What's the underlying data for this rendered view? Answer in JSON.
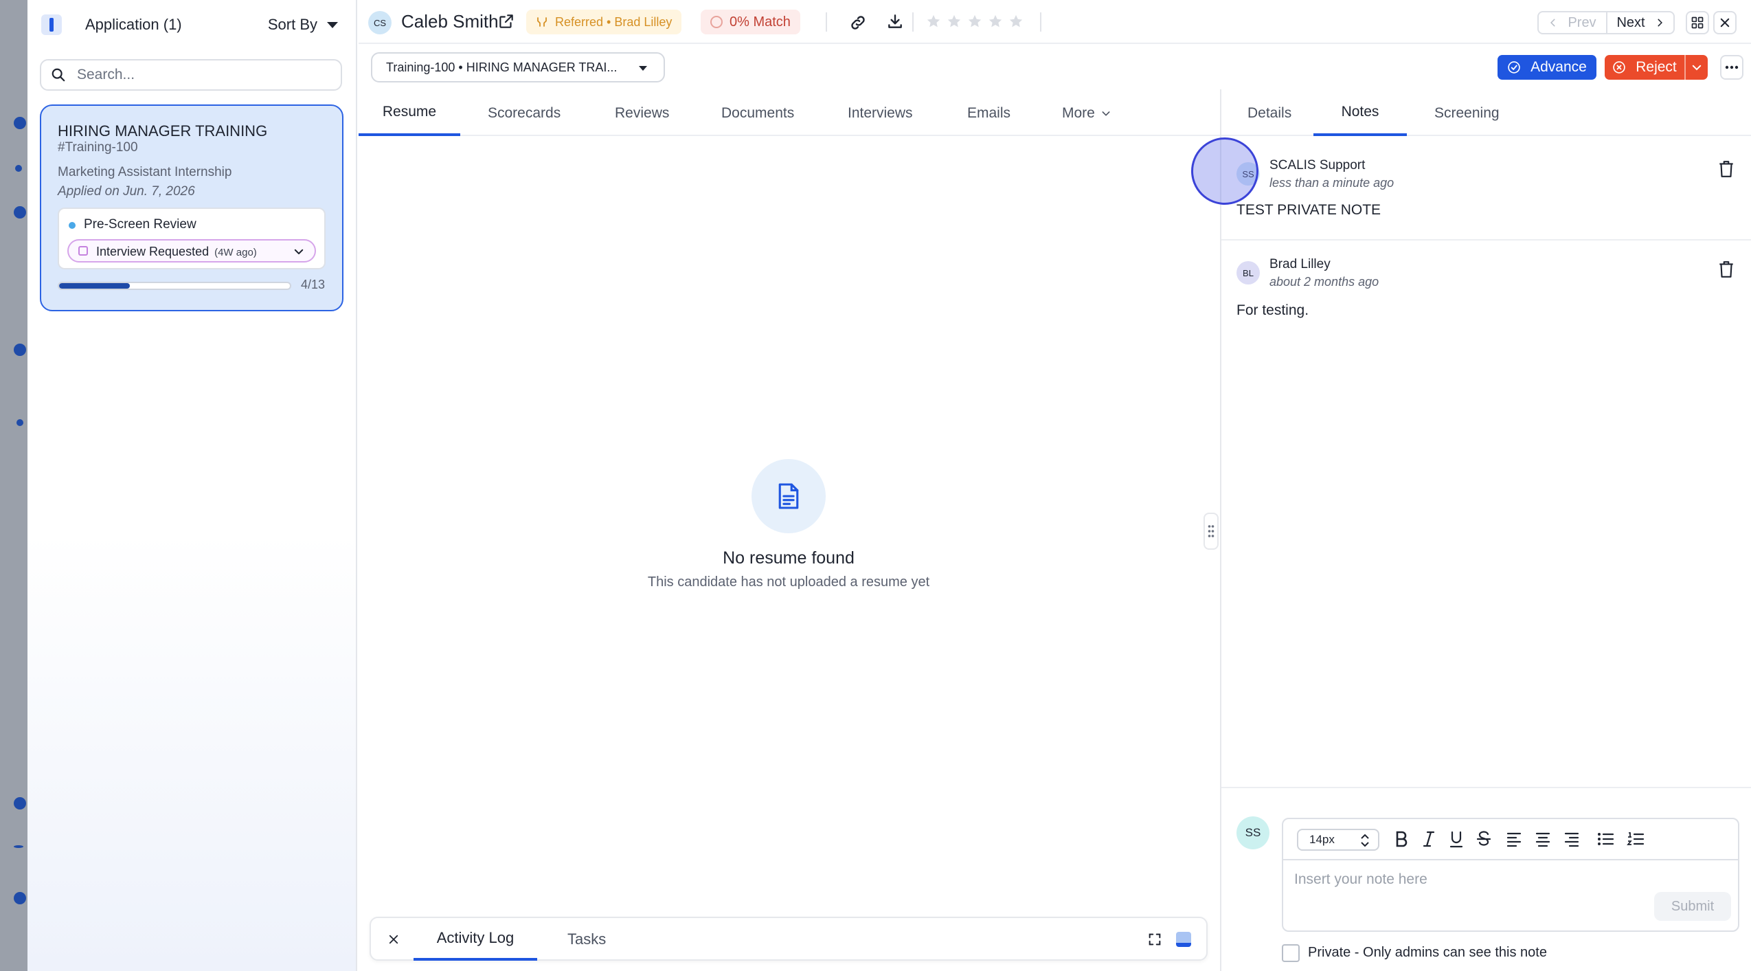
{
  "sidebar": {
    "app_title": "Application (1)",
    "sort_label": "Sort By",
    "search_placeholder": "Search...",
    "card": {
      "title": "HIRING MANAGER TRAINING",
      "code": "#Training-100",
      "job": "Marketing Assistant Internship",
      "applied": "Applied on Jun. 7, 2026",
      "stage": "Pre-Screen Review",
      "status": "Interview Requested",
      "status_ago": "(4W ago)",
      "progress_label": "4/13",
      "progress_fraction": 0.3077
    }
  },
  "header": {
    "avatar_initials": "CS",
    "candidate_name": "Caleb Smith",
    "referred": "Referred • Brad Lilley",
    "match": "0% Match",
    "rating": 0,
    "rating_max": 5,
    "prev_label": "Prev",
    "next_label": "Next"
  },
  "job_select": "Training-100 • HIRING MANAGER TRAI...",
  "actions": {
    "advance": "Advance",
    "reject": "Reject"
  },
  "tabs": [
    "Resume",
    "Scorecards",
    "Reviews",
    "Documents",
    "Interviews",
    "Emails",
    "More"
  ],
  "empty_state": {
    "title": "No resume found",
    "subtitle": "This candidate has not uploaded a resume yet"
  },
  "bottom_bar": {
    "activity": "Activity Log",
    "tasks": "Tasks"
  },
  "right_tabs": [
    "Details",
    "Notes",
    "Screening"
  ],
  "notes": [
    {
      "initials": "SS",
      "author": "SCALIS Support",
      "time": "less than a minute ago",
      "body": "TEST PRIVATE NOTE"
    },
    {
      "initials": "BL",
      "author": "Brad Lilley",
      "time": "about 2 months ago",
      "body": "For testing."
    }
  ],
  "composer": {
    "avatar_initials": "SS",
    "font_size": "14px",
    "placeholder": "Insert your note here",
    "submit": "Submit",
    "private_label": "Private - Only admins can see this note"
  },
  "colors": {
    "accent": "#1f56e0",
    "reject": "#eb4b2b",
    "referred_text": "#d69024",
    "match_text": "#c24134"
  }
}
